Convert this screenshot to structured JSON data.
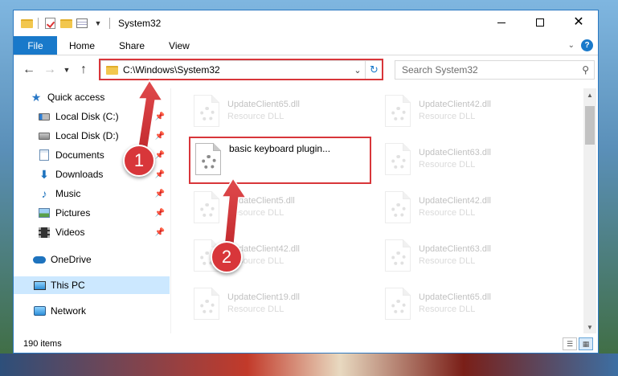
{
  "window": {
    "title": "System32",
    "controls": {
      "minimize": "—",
      "maximize": "☐",
      "close": "✕"
    }
  },
  "ribbon": {
    "tabs": [
      "File",
      "Home",
      "Share",
      "View"
    ],
    "help": "?"
  },
  "nav": {
    "address": "C:\\Windows\\System32",
    "search_placeholder": "Search System32"
  },
  "sidebar": {
    "items": [
      {
        "label": "Quick access",
        "icon": "star-icon",
        "pinned": false
      },
      {
        "label": "Local Disk (C:)",
        "icon": "drive-icon",
        "pinned": true
      },
      {
        "label": "Local Disk (D:)",
        "icon": "drive-icon",
        "pinned": true
      },
      {
        "label": "Documents",
        "icon": "documents-icon",
        "pinned": true
      },
      {
        "label": "Downloads",
        "icon": "downloads-icon",
        "pinned": true
      },
      {
        "label": "Music",
        "icon": "music-icon",
        "pinned": true
      },
      {
        "label": "Pictures",
        "icon": "pictures-icon",
        "pinned": true
      },
      {
        "label": "Videos",
        "icon": "videos-icon",
        "pinned": true
      },
      {
        "label": "OneDrive",
        "icon": "onedrive-icon",
        "pinned": false
      },
      {
        "label": "This PC",
        "icon": "this-pc-icon",
        "pinned": false,
        "selected": true
      },
      {
        "label": "Network",
        "icon": "network-icon",
        "pinned": false
      }
    ]
  },
  "files": [
    {
      "name": "UpdateClient65.dll",
      "desc": "Resource DLL"
    },
    {
      "name": "UpdateClient42.dll",
      "desc": "Resource DLL"
    },
    {
      "name": "basic keyboard plugin...",
      "desc": ""
    },
    {
      "name": "UpdateClient63.dll",
      "desc": "Resource DLL"
    },
    {
      "name": "UpdateClient5.dll",
      "desc": "Resource DLL"
    },
    {
      "name": "UpdateClient42.dll",
      "desc": "Resource DLL"
    },
    {
      "name": "UpdateClient42.dll",
      "desc": "Resource DLL"
    },
    {
      "name": "UpdateClient63.dll",
      "desc": "Resource DLL"
    },
    {
      "name": "UpdateClient19.dll",
      "desc": "Resource DLL"
    },
    {
      "name": "UpdateClient65.dll",
      "desc": "Resource DLL"
    }
  ],
  "status": {
    "count": "190 items"
  },
  "annotations": {
    "step1": "1",
    "step2": "2"
  },
  "colors": {
    "accent": "#1979ca",
    "highlight": "#d8363a",
    "selected": "#cce8ff"
  }
}
